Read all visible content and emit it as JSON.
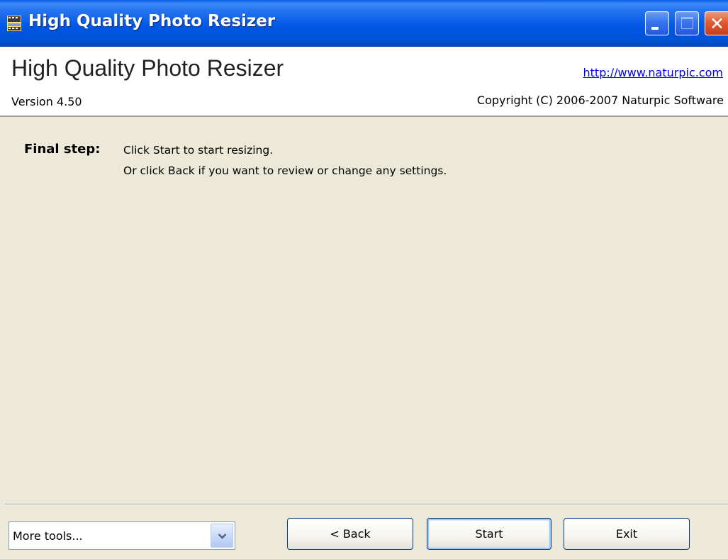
{
  "window": {
    "title": "High Quality Photo Resizer",
    "controls": {
      "minimize": "minimize-icon",
      "maximize": "maximize-icon",
      "close": "close-icon"
    }
  },
  "header": {
    "title": "High Quality Photo Resizer",
    "link": "http://www.naturpic.com",
    "version": "Version 4.50",
    "copyright": "Copyright (C) 2006-2007 Naturpic Software"
  },
  "step": {
    "label": "Final step:",
    "line1": "Click Start to start resizing.",
    "line2": "Or click Back if you want to review or change any settings."
  },
  "footer": {
    "tools_select": {
      "value": "More tools...",
      "icon": "chevron-down-icon"
    },
    "back_label": "< Back",
    "start_label": "Start",
    "exit_label": "Exit"
  },
  "colors": {
    "titlebar": "#0058E6",
    "close_button": "#E35A2E",
    "window_bg": "#ECE9D8",
    "link": "#0000EE"
  }
}
